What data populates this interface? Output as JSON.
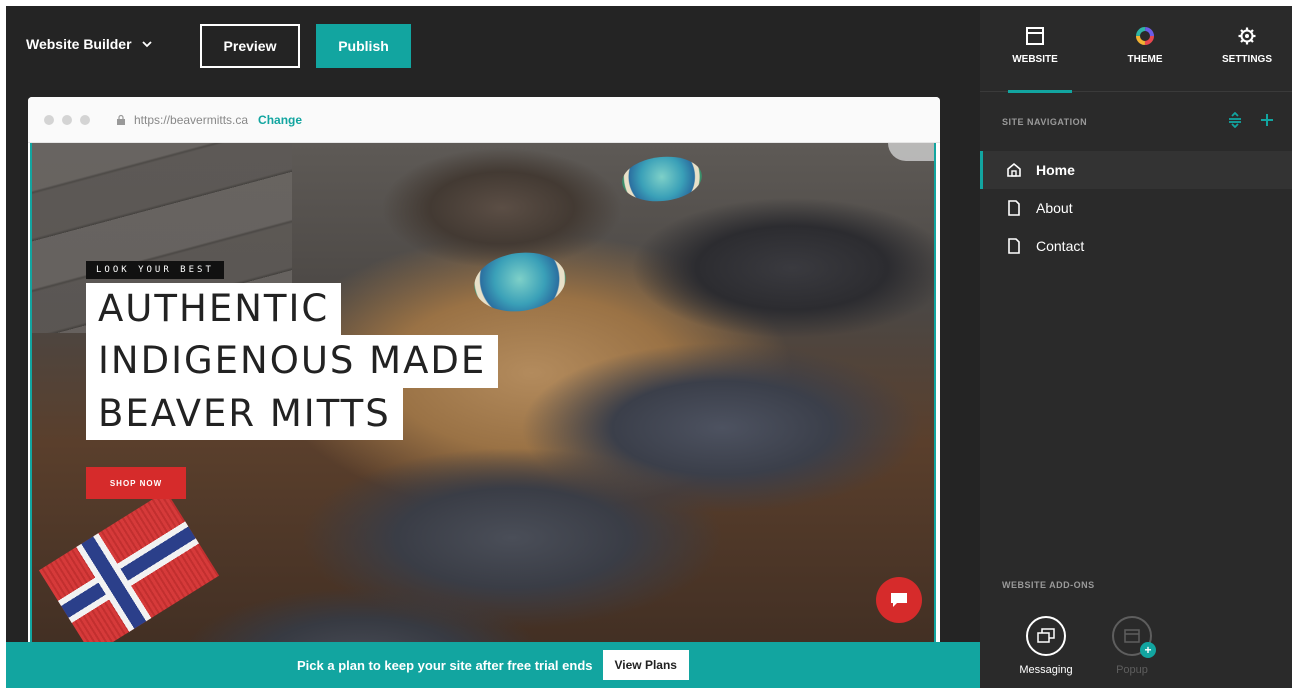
{
  "topbar": {
    "brand": "Website Builder",
    "preview_label": "Preview",
    "publish_label": "Publish"
  },
  "browser": {
    "url": "https://beavermitts.ca",
    "change_label": "Change"
  },
  "hero": {
    "kicker": "LOOK YOUR BEST",
    "headline": [
      "AUTHENTIC",
      "INDIGENOUS MADE",
      "BEAVER MITTS"
    ],
    "cta": "SHOP NOW"
  },
  "banner": {
    "text": "Pick a plan to keep your site after free trial ends",
    "button": "View Plans"
  },
  "panel": {
    "tabs": [
      {
        "label": "WEBSITE",
        "icon": "website-icon"
      },
      {
        "label": "THEME",
        "icon": "theme-color-wheel-icon"
      },
      {
        "label": "SETTINGS",
        "icon": "gear-icon"
      }
    ],
    "site_nav_title": "SITE NAVIGATION",
    "nav_items": [
      {
        "label": "Home",
        "icon": "home-icon"
      },
      {
        "label": "About",
        "icon": "page-icon"
      },
      {
        "label": "Contact",
        "icon": "page-icon"
      }
    ],
    "addons_title": "WEBSITE ADD-ONS",
    "addons": [
      {
        "label": "Messaging",
        "icon": "messaging-icon"
      },
      {
        "label": "Popup",
        "icon": "popup-icon"
      }
    ]
  },
  "colors": {
    "accent": "#12a5a0",
    "cta_red": "#d62b2b",
    "panel_bg": "#2a2a2a",
    "topbar_bg": "#242424"
  }
}
